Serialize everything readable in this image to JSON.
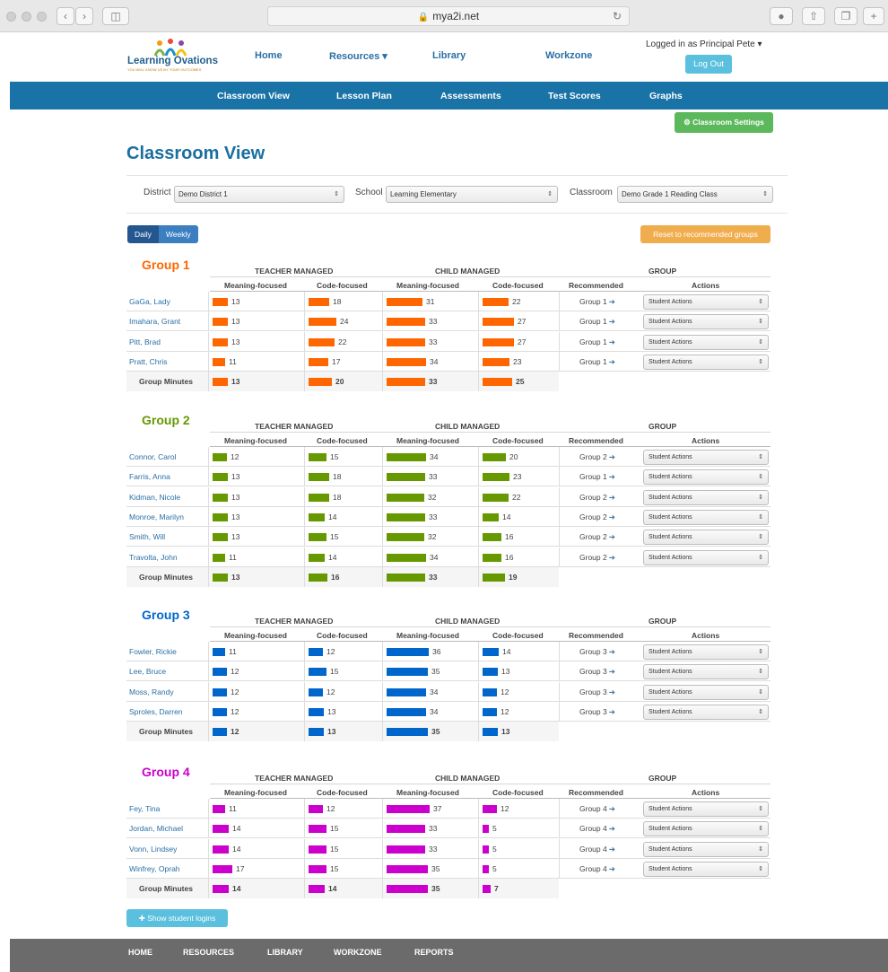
{
  "browser": {
    "url": "mya2i.net",
    "plus": "+"
  },
  "header": {
    "logo_text": "Learning Ovations",
    "logo_tagline": "YOU WILL KNOW US BY YOUR OUTCOMES",
    "nav": [
      "Home",
      "Resources ▾",
      "Library",
      "Workzone"
    ],
    "login_text": "Logged in as Principal Pete ▾",
    "logout_label": "Log Out"
  },
  "subnav": [
    "Classroom View",
    "Lesson Plan",
    "Assessments",
    "Test Scores",
    "Graphs"
  ],
  "settings_label": "Classroom Settings",
  "page_title": "Classroom View",
  "filters": {
    "district_label": "District",
    "district_value": "Demo District 1",
    "school_label": "School",
    "school_value": "Learning Elementary",
    "classroom_label": "Classroom",
    "classroom_value": "Demo Grade 1 Reading Class"
  },
  "toggle": {
    "daily": "Daily",
    "weekly": "Weekly"
  },
  "reset_label": "Reset to recommended groups",
  "table_headers": {
    "teacher_managed": "TEACHER MANAGED",
    "child_managed": "CHILD MANAGED",
    "group": "GROUP",
    "meaning": "Meaning-focused",
    "code": "Code-focused",
    "recommended": "Recommended",
    "actions": "Actions",
    "group_minutes": "Group Minutes",
    "student_actions": "Student Actions"
  },
  "groups": [
    {
      "title": "Group 1",
      "color": "#ff6600",
      "students": [
        {
          "name": "GaGa, Lady",
          "tm_meaning": 13,
          "tm_code": 18,
          "cm_meaning": 31,
          "cm_code": 22,
          "rec": "Group 1"
        },
        {
          "name": "Imahara, Grant",
          "tm_meaning": 13,
          "tm_code": 24,
          "cm_meaning": 33,
          "cm_code": 27,
          "rec": "Group 1"
        },
        {
          "name": "Pitt, Brad",
          "tm_meaning": 13,
          "tm_code": 22,
          "cm_meaning": 33,
          "cm_code": 27,
          "rec": "Group 1"
        },
        {
          "name": "Pratt, Chris",
          "tm_meaning": 11,
          "tm_code": 17,
          "cm_meaning": 34,
          "cm_code": 23,
          "rec": "Group 1"
        }
      ],
      "minutes": {
        "tm_meaning": 13,
        "tm_code": 20,
        "cm_meaning": 33,
        "cm_code": 25
      }
    },
    {
      "title": "Group 2",
      "color": "#669900",
      "students": [
        {
          "name": "Connor, Carol",
          "tm_meaning": 12,
          "tm_code": 15,
          "cm_meaning": 34,
          "cm_code": 20,
          "rec": "Group 2"
        },
        {
          "name": "Farris, Anna",
          "tm_meaning": 13,
          "tm_code": 18,
          "cm_meaning": 33,
          "cm_code": 23,
          "rec": "Group 1"
        },
        {
          "name": "Kidman, Nicole",
          "tm_meaning": 13,
          "tm_code": 18,
          "cm_meaning": 32,
          "cm_code": 22,
          "rec": "Group 2"
        },
        {
          "name": "Monroe, Marilyn",
          "tm_meaning": 13,
          "tm_code": 14,
          "cm_meaning": 33,
          "cm_code": 14,
          "rec": "Group 2"
        },
        {
          "name": "Smith, Will",
          "tm_meaning": 13,
          "tm_code": 15,
          "cm_meaning": 32,
          "cm_code": 16,
          "rec": "Group 2"
        },
        {
          "name": "Travolta, John",
          "tm_meaning": 11,
          "tm_code": 14,
          "cm_meaning": 34,
          "cm_code": 16,
          "rec": "Group 2"
        }
      ],
      "minutes": {
        "tm_meaning": 13,
        "tm_code": 16,
        "cm_meaning": 33,
        "cm_code": 19
      }
    },
    {
      "title": "Group 3",
      "color": "#0066cc",
      "students": [
        {
          "name": "Fowler, Rickie",
          "tm_meaning": 11,
          "tm_code": 12,
          "cm_meaning": 36,
          "cm_code": 14,
          "rec": "Group 3"
        },
        {
          "name": "Lee, Bruce",
          "tm_meaning": 12,
          "tm_code": 15,
          "cm_meaning": 35,
          "cm_code": 13,
          "rec": "Group 3"
        },
        {
          "name": "Moss, Randy",
          "tm_meaning": 12,
          "tm_code": 12,
          "cm_meaning": 34,
          "cm_code": 12,
          "rec": "Group 3"
        },
        {
          "name": "Sproles, Darren",
          "tm_meaning": 12,
          "tm_code": 13,
          "cm_meaning": 34,
          "cm_code": 12,
          "rec": "Group 3"
        }
      ],
      "minutes": {
        "tm_meaning": 12,
        "tm_code": 13,
        "cm_meaning": 35,
        "cm_code": 13
      }
    },
    {
      "title": "Group 4",
      "color": "#cc00cc",
      "students": [
        {
          "name": "Fey, Tina",
          "tm_meaning": 11,
          "tm_code": 12,
          "cm_meaning": 37,
          "cm_code": 12,
          "rec": "Group 4"
        },
        {
          "name": "Jordan, Michael",
          "tm_meaning": 14,
          "tm_code": 15,
          "cm_meaning": 33,
          "cm_code": 5,
          "rec": "Group 4"
        },
        {
          "name": "Vonn, Lindsey",
          "tm_meaning": 14,
          "tm_code": 15,
          "cm_meaning": 33,
          "cm_code": 5,
          "rec": "Group 4"
        },
        {
          "name": "Winfrey, Oprah",
          "tm_meaning": 17,
          "tm_code": 15,
          "cm_meaning": 35,
          "cm_code": 5,
          "rec": "Group 4"
        }
      ],
      "minutes": {
        "tm_meaning": 14,
        "tm_code": 14,
        "cm_meaning": 35,
        "cm_code": 7
      }
    }
  ],
  "show_logins_label": "Show student logins",
  "footer": [
    "HOME",
    "RESOURCES",
    "LIBRARY",
    "WORKZONE",
    "REPORTS"
  ]
}
